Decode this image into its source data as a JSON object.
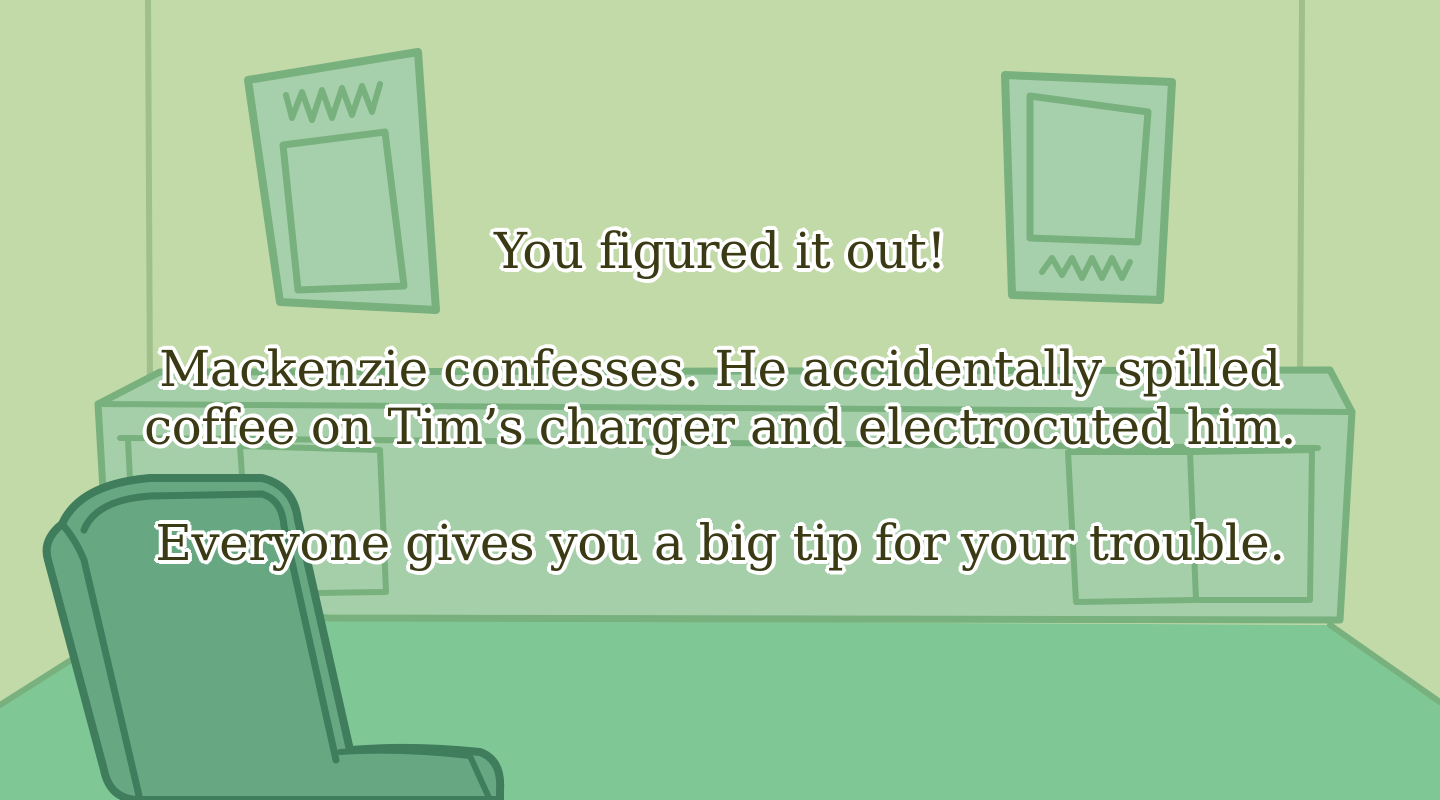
{
  "narration": {
    "line1": "You figured it out!",
    "line2": "Mackenzie confesses. He accidentally spilled",
    "line3": "coffee on Tim’s charger and electrocuted him.",
    "line4": "Everyone gives you a big tip for your trouble."
  },
  "palette": {
    "wall": "#c2d9a8",
    "floor": "#80c796",
    "furniture_fill": "#a5cfa8",
    "line": "#78b07e",
    "chair": "#67a883",
    "chair_outline": "#3f7d5d",
    "text": "#3a3a14",
    "text_outline": "#ffffff"
  }
}
